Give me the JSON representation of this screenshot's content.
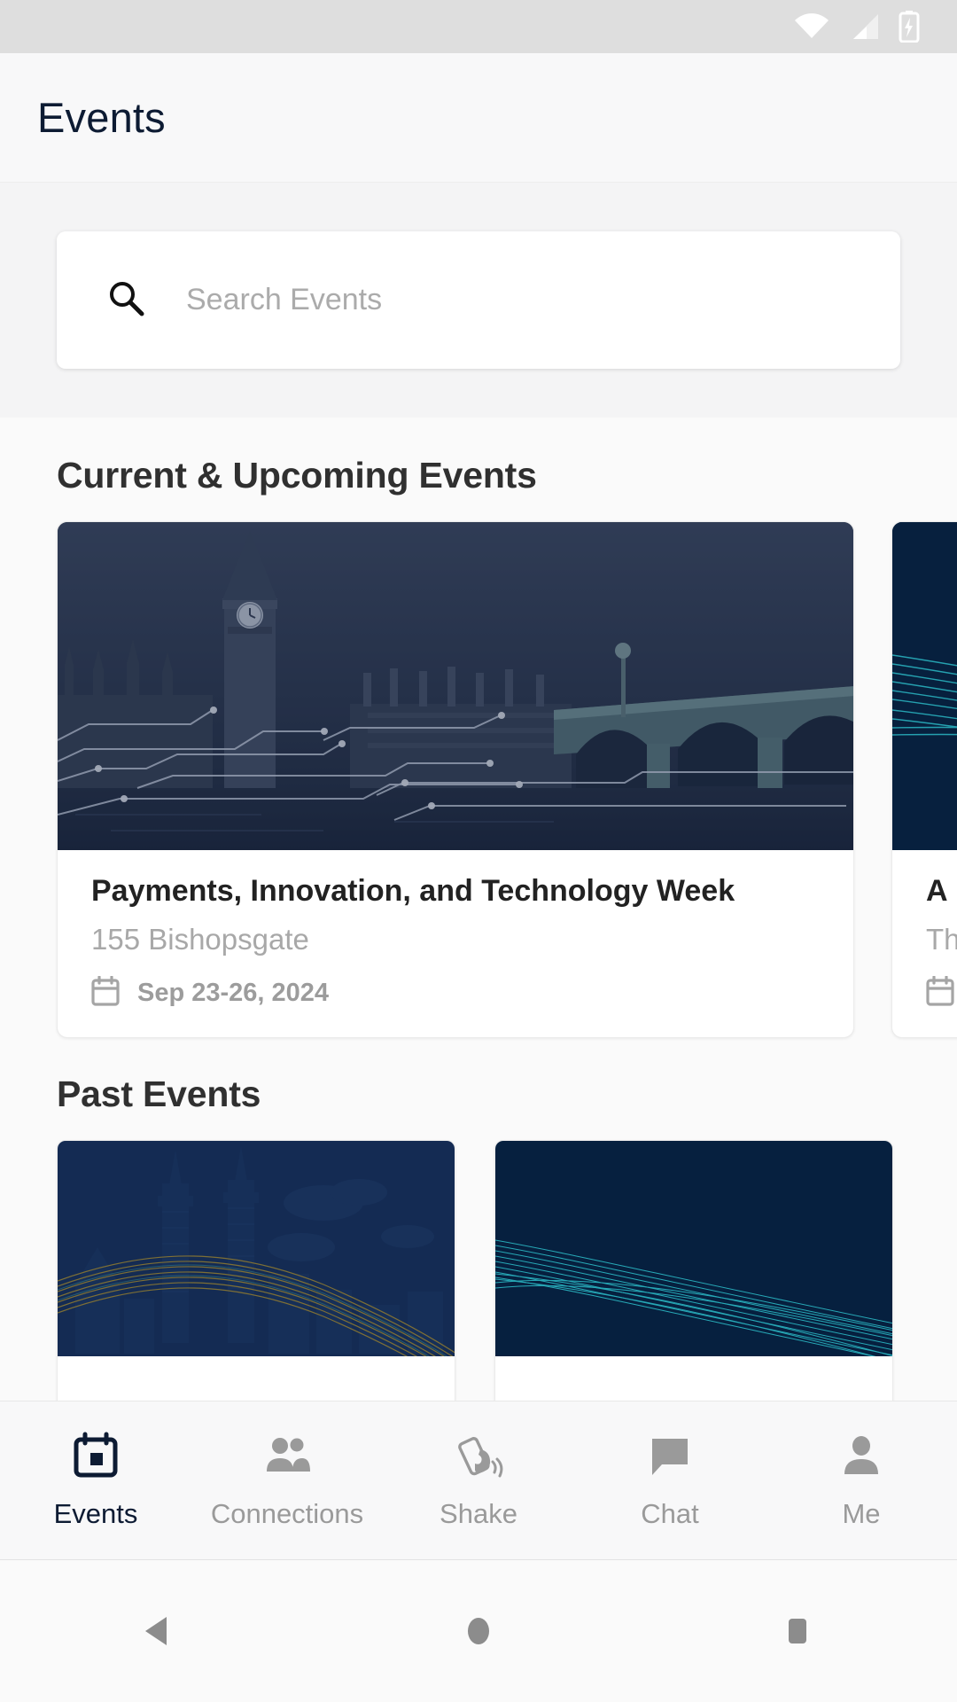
{
  "status_bar": {
    "icons": [
      "wifi-icon",
      "cellular-signal-icon",
      "battery-charging-icon"
    ],
    "background": "#DEDEDE",
    "icon_color": "#FFFFFF"
  },
  "header": {
    "title": "Events",
    "title_color": "#0D1B33"
  },
  "search": {
    "placeholder": "Search Events",
    "value": "",
    "icon": "search-icon"
  },
  "sections": {
    "upcoming_title": "Current & Upcoming Events",
    "past_title": "Past Events"
  },
  "upcoming_events": [
    {
      "title": "Payments, Innovation, and Technology Week",
      "venue": "155 Bishopsgate",
      "date": "Sep 23-26, 2024",
      "date_icon": "calendar-icon",
      "banner": "london-westminster-bridge-big-ben"
    },
    {
      "title": "A",
      "venue": "Th",
      "date": "",
      "date_icon": "calendar-icon",
      "banner": "navy-cyan-lines"
    }
  ],
  "past_events": [
    {
      "banner": "kuala-lumpur-petronas-towers-gold-lines"
    },
    {
      "banner": "navy-cyan-swoosh-lines"
    }
  ],
  "bottom_nav": {
    "items": [
      {
        "label": "Events",
        "icon": "calendar-event-icon",
        "active": true
      },
      {
        "label": "Connections",
        "icon": "people-icon",
        "active": false
      },
      {
        "label": "Shake",
        "icon": "shake-phone-icon",
        "active": false
      },
      {
        "label": "Chat",
        "icon": "chat-bubble-icon",
        "active": false
      },
      {
        "label": "Me",
        "icon": "person-icon",
        "active": false
      }
    ],
    "active_color": "#0D1B33",
    "inactive_color": "#9A9A9A"
  },
  "android_nav": {
    "buttons": [
      {
        "name": "back-button",
        "icon": "triangle-left-icon"
      },
      {
        "name": "home-button",
        "icon": "circle-icon"
      },
      {
        "name": "recents-button",
        "icon": "square-icon"
      }
    ],
    "color": "#8C8C8C"
  },
  "colors": {
    "brand_navy": "#0D1B33",
    "page_bg": "#FAFAFA",
    "search_band_bg": "#F4F4F5",
    "card_bg": "#FFFFFF",
    "muted_text": "#A8A8A8",
    "accent_cyan": "#2BB8C4",
    "accent_gold": "#C9A227"
  }
}
